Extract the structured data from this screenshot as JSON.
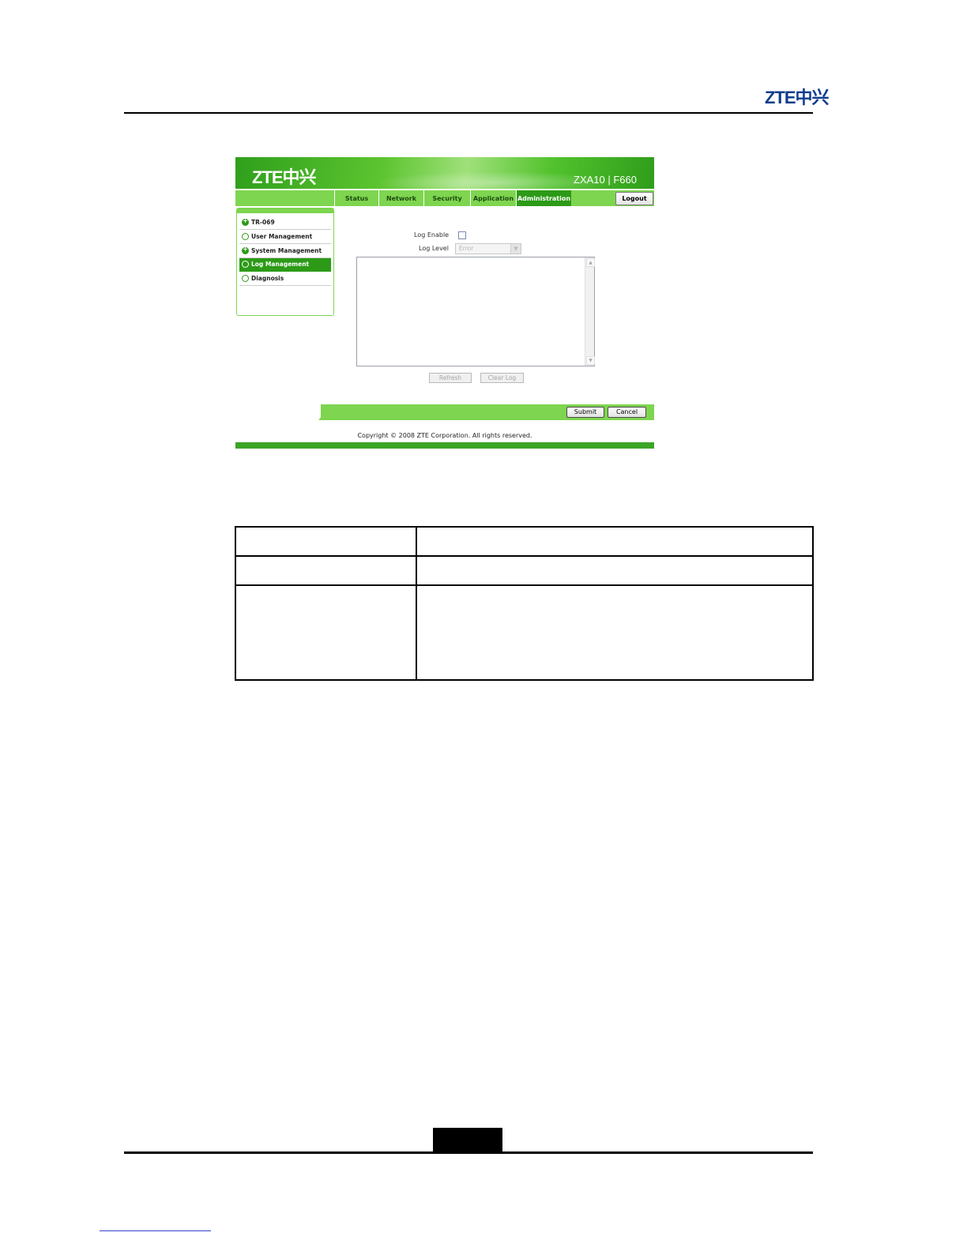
{
  "page": {
    "header_logo": "ZTE中兴"
  },
  "screenshot": {
    "banner": {
      "logo": "ZTE中兴",
      "model": "ZXA10 | F660"
    },
    "nav": {
      "tabs": [
        {
          "label": "Status",
          "active": false
        },
        {
          "label": "Network",
          "active": false
        },
        {
          "label": "Security",
          "active": false
        },
        {
          "label": "Application",
          "active": false
        },
        {
          "label": "Administration",
          "active": true
        }
      ],
      "logout_label": "Logout"
    },
    "sidebar": {
      "items": [
        {
          "label": "TR-069",
          "icon": "plus-circle-icon",
          "active": false
        },
        {
          "label": "User Management",
          "icon": "circle-icon",
          "active": false
        },
        {
          "label": "System Management",
          "icon": "plus-circle-icon",
          "active": false
        },
        {
          "label": "Log Management",
          "icon": "circle-icon",
          "active": true
        },
        {
          "label": "Diagnosis",
          "icon": "circle-icon",
          "active": false
        }
      ]
    },
    "form": {
      "log_enable_label": "Log Enable",
      "log_enable_checked": false,
      "log_level_label": "Log Level",
      "log_level_value": "Error",
      "log_text": ""
    },
    "buttons": {
      "refresh": "Refresh",
      "clear_log": "Clear Log",
      "submit": "Submit",
      "cancel": "Cancel"
    },
    "copyright": "Copyright © 2008 ZTE Corporation. All rights reserved."
  },
  "table": {
    "rows": [
      [
        "",
        ""
      ],
      [
        "",
        ""
      ],
      [
        "",
        ""
      ]
    ]
  },
  "colors": {
    "brand_green": "#2c9a17",
    "light_green": "#7ed54f",
    "logo_blue": "#0f3c8c"
  }
}
